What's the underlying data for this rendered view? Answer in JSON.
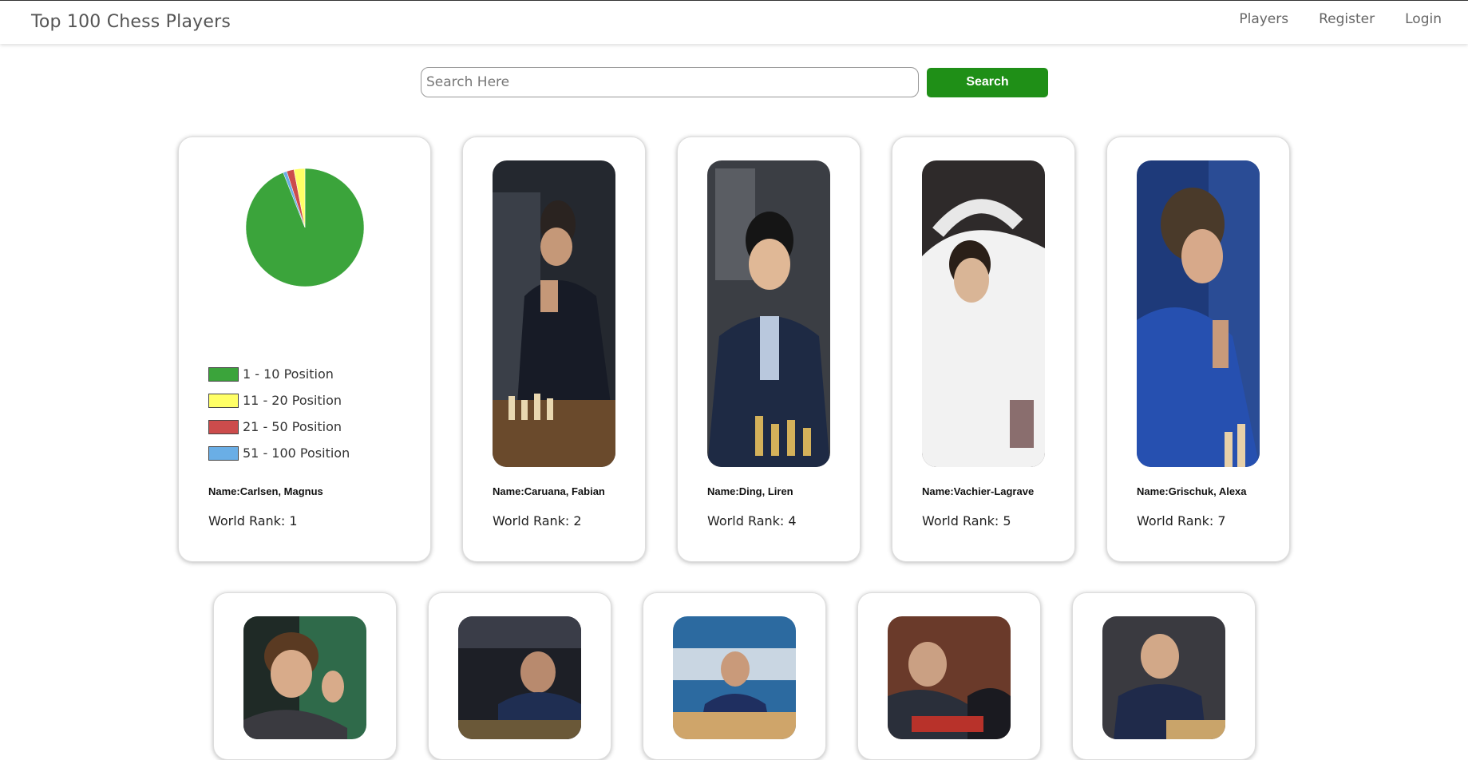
{
  "navbar": {
    "brand": "Top 100 Chess Players",
    "links": [
      "Players",
      "Register",
      "Login"
    ]
  },
  "search": {
    "placeholder": "Search Here",
    "value": "",
    "button_label": "Search"
  },
  "colors": {
    "search_button": "#1f8f17",
    "pie_green": "#3ba43b",
    "pie_yellow": "#ffff66",
    "pie_red": "#cc4c4c",
    "pie_blue": "#6aaee6"
  },
  "chart_data": {
    "type": "pie",
    "labels": [
      "1 - 10 Position",
      "11 - 20 Position",
      "21 - 50 Position",
      "51 - 100 Position"
    ],
    "values": [
      94,
      3,
      2,
      1
    ],
    "colors": [
      "#3ba43b",
      "#ffff66",
      "#cc4c4c",
      "#6aaee6"
    ]
  },
  "featured": {
    "name": "Name:Carlsen, Magnus",
    "rank": "World Rank: 1"
  },
  "players_row1": [
    {
      "name": "Name:Caruana, Fabian",
      "rank": "World Rank: 2"
    },
    {
      "name": "Name:Ding, Liren",
      "rank": "World Rank: 4"
    },
    {
      "name": "Name:Vachier-Lagrave",
      "rank": "World Rank: 5"
    },
    {
      "name": "Name:Grischuk, Alexa",
      "rank": "World Rank: 7"
    }
  ]
}
